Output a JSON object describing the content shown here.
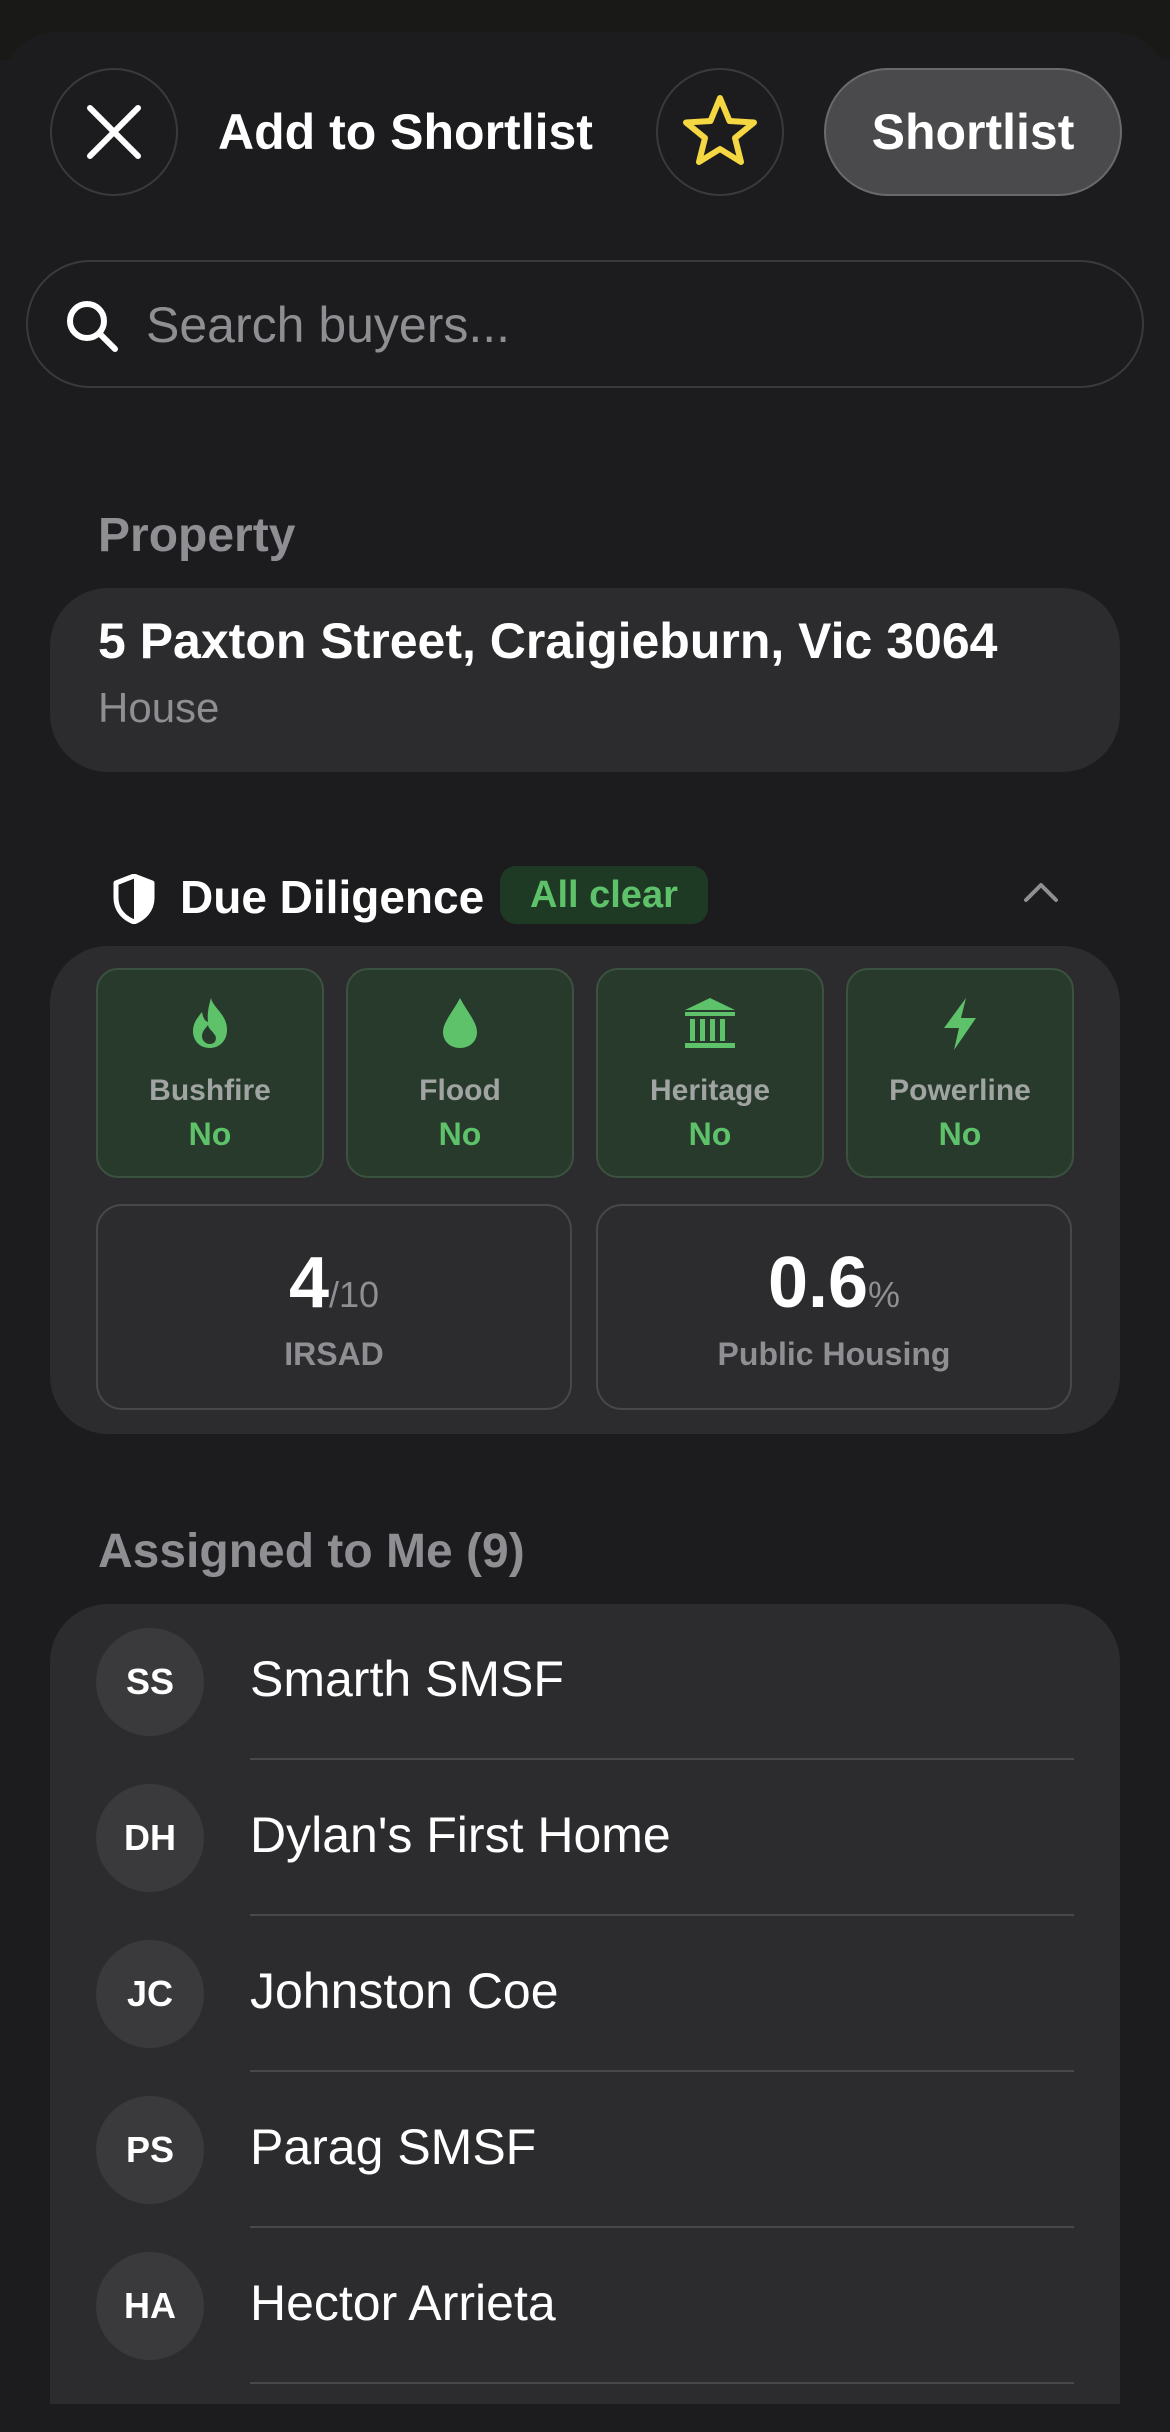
{
  "header": {
    "title": "Add to Shortlist",
    "shortlist_button": "Shortlist"
  },
  "search": {
    "placeholder": "Search buyers..."
  },
  "property": {
    "section_label": "Property",
    "address": "5 Paxton Street, Craigieburn, Vic 3064",
    "type": "House"
  },
  "due_diligence": {
    "title": "Due Diligence",
    "status_badge": "All clear",
    "expanded": true,
    "risks": [
      {
        "name": "Bushfire",
        "value": "No",
        "icon": "fire-icon"
      },
      {
        "name": "Flood",
        "value": "No",
        "icon": "droplet-icon"
      },
      {
        "name": "Heritage",
        "value": "No",
        "icon": "heritage-building-icon"
      },
      {
        "name": "Powerline",
        "value": "No",
        "icon": "lightning-bolt-icon"
      }
    ],
    "metrics": [
      {
        "value": "4",
        "suffix": "/10",
        "label": "IRSAD"
      },
      {
        "value": "0.6",
        "suffix": "%",
        "label": "Public Housing"
      }
    ]
  },
  "assigned": {
    "section_label": "Assigned to Me (9)",
    "buyers": [
      {
        "initials": "SS",
        "name": "Smarth SMSF"
      },
      {
        "initials": "DH",
        "name": "Dylan's First Home"
      },
      {
        "initials": "JC",
        "name": "Johnston Coe"
      },
      {
        "initials": "PS",
        "name": "Parag SMSF"
      },
      {
        "initials": "HA",
        "name": "Hector Arrieta"
      }
    ]
  },
  "colors": {
    "background": "#1c1c1e",
    "card": "#2c2c2e",
    "accent_green": "#5ec26a",
    "star_yellow": "#f5d742"
  }
}
